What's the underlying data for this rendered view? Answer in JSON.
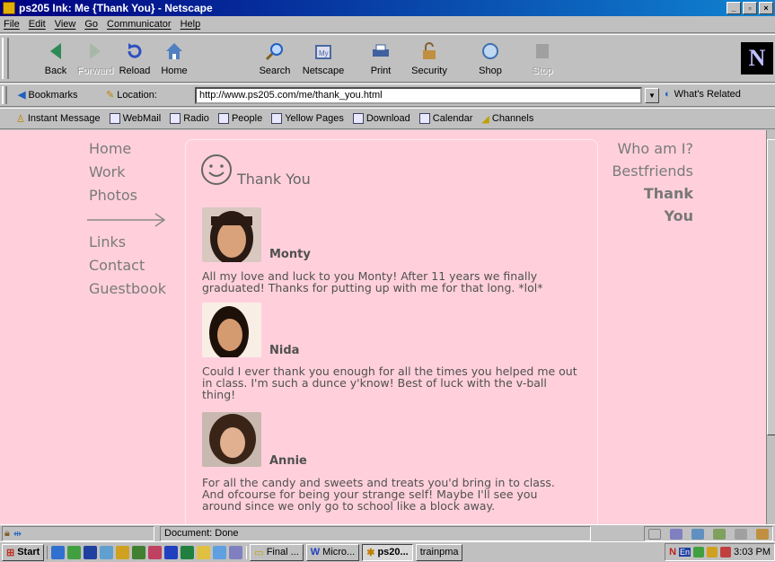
{
  "window": {
    "title": "ps205 Ink: Me {Thank You} - Netscape",
    "controls": [
      "_",
      "▫",
      "×"
    ]
  },
  "menu": [
    "File",
    "Edit",
    "View",
    "Go",
    "Communicator",
    "Help"
  ],
  "nav_toolbar": {
    "buttons": [
      {
        "label": "Back",
        "enabled": true,
        "icon": "back-arrow-icon",
        "color": "#2e8b57"
      },
      {
        "label": "Forward",
        "enabled": false,
        "icon": "forward-arrow-icon",
        "color": "#9aaa9a"
      },
      {
        "label": "Reload",
        "enabled": true,
        "icon": "reload-icon",
        "color": "#3050c0"
      },
      {
        "label": "Home",
        "enabled": true,
        "icon": "home-icon",
        "color": "#5080c0"
      },
      {
        "label": "Search",
        "enabled": true,
        "icon": "search-icon",
        "color": "#2060c0"
      },
      {
        "label": "Netscape",
        "enabled": true,
        "icon": "my-netscape-icon",
        "color": "#4a6aa0"
      },
      {
        "label": "Print",
        "enabled": true,
        "icon": "print-icon",
        "color": "#4060a0"
      },
      {
        "label": "Security",
        "enabled": true,
        "icon": "security-lock-icon",
        "color": "#806030"
      },
      {
        "label": "Shop",
        "enabled": true,
        "icon": "shop-icon",
        "color": "#4070b0"
      },
      {
        "label": "Stop",
        "enabled": false,
        "icon": "stop-icon",
        "color": "#909090"
      }
    ],
    "logo": "N"
  },
  "location_bar": {
    "bookmarks_label": "Bookmarks",
    "location_label": "Location:",
    "url": "http://www.ps205.com/me/thank_you.html",
    "related_label": "What's Related"
  },
  "personal_toolbar": [
    "Instant Message",
    "WebMail",
    "Radio",
    "People",
    "Yellow Pages",
    "Download",
    "Calendar",
    "Channels"
  ],
  "page": {
    "left_nav": [
      "Home",
      "Work",
      "Photos",
      "Links",
      "Contact",
      "Guestbook"
    ],
    "right_nav": [
      "Who am I?",
      "Bestfriends",
      "Thank You"
    ],
    "heading": "Thank You",
    "entries": [
      {
        "name": "Monty",
        "text": "All my love and luck to you Monty! After 11 years we finally graduated! Thanks for putting up with me for that long. *lol*"
      },
      {
        "name": "Nida",
        "text": "Could I ever thank you enough for all the times you helped me out in class. I'm such a dunce y'know! Best of luck with the v-ball thing!"
      },
      {
        "name": "Annie",
        "text": "For all the candy and sweets and treats you'd bring in to class. And ofcourse for being your strange self! Maybe I'll see you around since we only go to school like a block away."
      }
    ],
    "background": "#ffd0dc"
  },
  "status": {
    "text": "Document: Done"
  },
  "taskbar": {
    "start": "Start",
    "tasks": [
      "Final ...",
      "Micro...",
      "ps20...",
      "trainpma"
    ],
    "clock": "3:03 PM"
  }
}
